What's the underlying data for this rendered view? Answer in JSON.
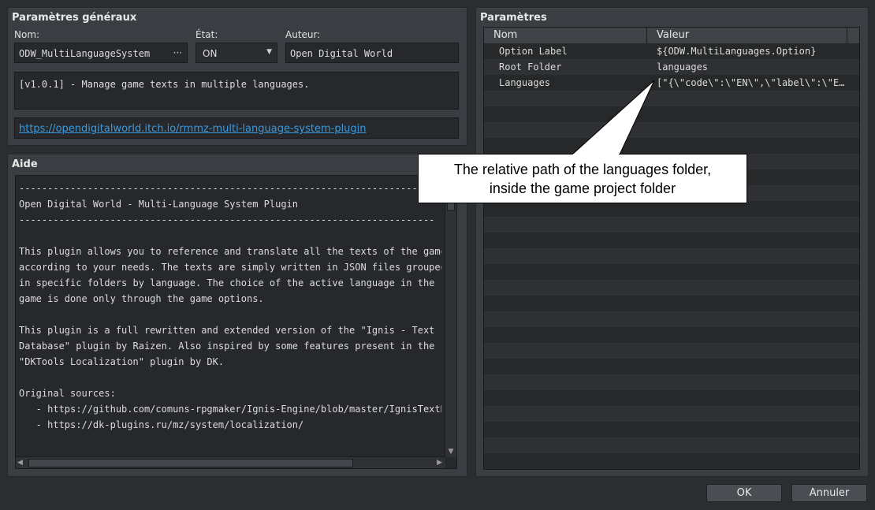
{
  "general": {
    "title": "Paramètres généraux",
    "name_label": "Nom:",
    "name_value": "ODW_MultiLanguageSystem",
    "name_more": "···",
    "state_label": "État:",
    "state_value": "ON",
    "author_label": "Auteur:",
    "author_value": "Open Digital World",
    "description": "[v1.0.1] - Manage game texts in multiple languages.",
    "url": "https://opendigitalworld.itch.io/rmmz-multi-language-system-plugin"
  },
  "help": {
    "title": "Aide",
    "text": "-------------------------------------------------------------------------\nOpen Digital World - Multi-Language System Plugin\n-------------------------------------------------------------------------\n\nThis plugin allows you to reference and translate all the texts of the game\naccording to your needs. The texts are simply written in JSON files grouped\nin specific folders by language. The choice of the active language in the\ngame is done only through the game options.\n\nThis plugin is a full rewritten and extended version of the \"Ignis - Text\nDatabase\" plugin by Raizen. Also inspired by some features present in the\n\"DKTools Localization\" plugin by DK.\n\nOriginal sources:\n   - https://github.com/comuns-rpgmaker/Ignis-Engine/blob/master/IgnisTextDatabase.js\n   - https://dk-plugins.ru/mz/system/localization/"
  },
  "params": {
    "title": "Paramètres",
    "col_name": "Nom",
    "col_value": "Valeur",
    "rows": [
      {
        "name": "Option Label",
        "value": "${ODW.MultiLanguages.Option}"
      },
      {
        "name": "Root Folder",
        "value": "languages"
      },
      {
        "name": "Languages",
        "value": "[\"{\\\"code\\\":\\\"EN\\\",\\\"label\\\":\\\"E…"
      }
    ]
  },
  "callout": {
    "line1": "The relative path of the languages folder,",
    "line2": "inside the game project folder"
  },
  "buttons": {
    "ok": "OK",
    "cancel": "Annuler"
  },
  "icons": {
    "dropdown": "chevron-down-icon"
  }
}
